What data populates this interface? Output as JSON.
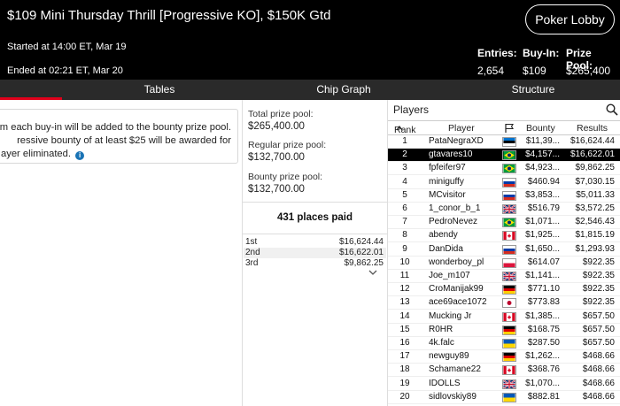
{
  "header": {
    "title": "$109 Mini Thursday Thrill [Progressive KO], $150K Gtd",
    "lobby_button": "Poker Lobby",
    "started": "Started at 14:00 ET, Mar 19",
    "ended": "Ended at 02:21 ET, Mar 20",
    "entries_label": "Entries:",
    "entries_value": "2,654",
    "buyin_label": "Buy-In:",
    "buyin_value": "$109",
    "prizepool_label": "Prize Pool:",
    "prizepool_value": "$265,400"
  },
  "tabs": [
    "Tables",
    "Chip Graph",
    "Structure"
  ],
  "info": {
    "line1": "m each buy-in will be added to the bounty prize pool.",
    "line2": "ressive bounty of at least $25 will be awarded for",
    "line3": "ayer eliminated.",
    "icon": "i"
  },
  "prizes": {
    "total_label": "Total prize pool:",
    "total_value": "$265,400.00",
    "regular_label": "Regular prize pool:",
    "regular_value": "$132,700.00",
    "bounty_label": "Bounty prize pool:",
    "bounty_value": "$132,700.00",
    "places_paid": "431 places paid",
    "payouts": [
      {
        "place": "1st",
        "amount": "$16,624.44"
      },
      {
        "place": "2nd",
        "amount": "$16,622.01"
      },
      {
        "place": "3rd",
        "amount": "$9,862.25"
      }
    ]
  },
  "players": {
    "title": "Players",
    "headers": {
      "rank": "Rank",
      "player": "Player",
      "bounty": "Bounty",
      "results": "Results"
    },
    "rows": [
      {
        "rank": "1",
        "name": "PataNegraXD",
        "flag": "ee",
        "bounty": "$11,39...",
        "result": "$16,624.44"
      },
      {
        "rank": "2",
        "name": "gtavares10",
        "flag": "br",
        "bounty": "$4,157...",
        "result": "$16,622.01",
        "selected": true
      },
      {
        "rank": "3",
        "name": "fpfeifer97",
        "flag": "br",
        "bounty": "$4,923...",
        "result": "$9,862.25"
      },
      {
        "rank": "4",
        "name": "miniguffy",
        "flag": "ru",
        "bounty": "$460.94",
        "result": "$7,030.15"
      },
      {
        "rank": "5",
        "name": "MCvisitor",
        "flag": "ru",
        "bounty": "$3,853...",
        "result": "$5,011.33"
      },
      {
        "rank": "6",
        "name": "1_conor_b_1",
        "flag": "gb",
        "bounty": "$516.79",
        "result": "$3,572.25"
      },
      {
        "rank": "7",
        "name": "PedroNevez",
        "flag": "br",
        "bounty": "$1,071...",
        "result": "$2,546.43"
      },
      {
        "rank": "8",
        "name": "abendy",
        "flag": "ca",
        "bounty": "$1,925...",
        "result": "$1,815.19"
      },
      {
        "rank": "9",
        "name": "DanDida",
        "flag": "ru",
        "bounty": "$1,650...",
        "result": "$1,293.93"
      },
      {
        "rank": "10",
        "name": "wonderboy_pl",
        "flag": "pl",
        "bounty": "$614.07",
        "result": "$922.35"
      },
      {
        "rank": "11",
        "name": "Joe_m107",
        "flag": "gb",
        "bounty": "$1,141...",
        "result": "$922.35"
      },
      {
        "rank": "12",
        "name": "CroManijak99",
        "flag": "de",
        "bounty": "$771.10",
        "result": "$922.35"
      },
      {
        "rank": "13",
        "name": "ace69ace1072",
        "flag": "jp",
        "bounty": "$773.83",
        "result": "$922.35"
      },
      {
        "rank": "14",
        "name": "Mucking Jr",
        "flag": "ca",
        "bounty": "$1,385...",
        "result": "$657.50"
      },
      {
        "rank": "15",
        "name": "R0HR",
        "flag": "de",
        "bounty": "$168.75",
        "result": "$657.50"
      },
      {
        "rank": "16",
        "name": "4k.falc",
        "flag": "ua",
        "bounty": "$287.50",
        "result": "$657.50"
      },
      {
        "rank": "17",
        "name": "newguy89",
        "flag": "de",
        "bounty": "$1,262...",
        "result": "$468.66"
      },
      {
        "rank": "18",
        "name": "Schamane22",
        "flag": "ca",
        "bounty": "$368.76",
        "result": "$468.66"
      },
      {
        "rank": "19",
        "name": "IDOLLS",
        "flag": "gb",
        "bounty": "$1,070...",
        "result": "$468.66"
      },
      {
        "rank": "20",
        "name": "sidlovskiy89",
        "flag": "ua",
        "bounty": "$882.81",
        "result": "$468.66"
      }
    ]
  },
  "colors": {
    "accent": "#e0001b",
    "selected_row": "#000000",
    "info_icon": "#1a73b5"
  }
}
